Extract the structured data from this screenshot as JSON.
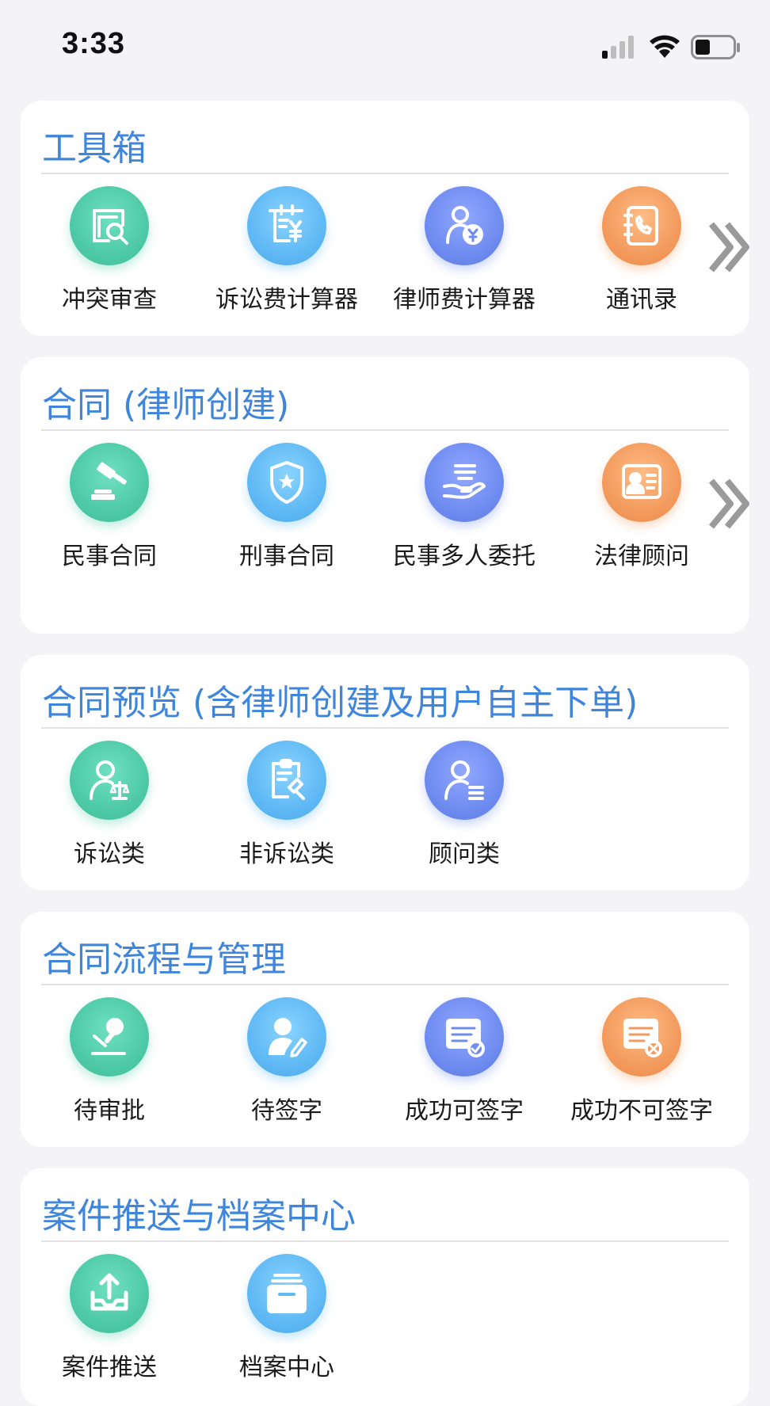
{
  "status_bar": {
    "time": "3:33"
  },
  "sections": [
    {
      "title": "工具箱",
      "items": [
        {
          "label": "冲突审查",
          "icon": "conflict-check-icon",
          "color": "#4fcaa6"
        },
        {
          "label": "诉讼费计算器",
          "icon": "litigation-fee-calculator-icon",
          "color": "#60b9f4"
        },
        {
          "label": "律师费计算器",
          "icon": "lawyer-fee-calculator-icon",
          "color": "#6f8cf0"
        },
        {
          "label": "通讯录",
          "icon": "address-book-icon",
          "color": "#f39b5e"
        }
      ],
      "has_more": true
    },
    {
      "title": "合同 (律师创建)",
      "items": [
        {
          "label": "民事合同",
          "icon": "gavel-icon",
          "color": "#4fcaa6"
        },
        {
          "label": "刑事合同",
          "icon": "shield-star-icon",
          "color": "#60b9f4"
        },
        {
          "label": "民事多人委托",
          "icon": "hand-document-icon",
          "color": "#6f8cf0"
        },
        {
          "label": "法律顾问",
          "icon": "id-card-icon",
          "color": "#f39b5e"
        }
      ],
      "has_more": true
    },
    {
      "title": "合同预览 (含律师创建及用户自主下单)",
      "items": [
        {
          "label": "诉讼类",
          "icon": "person-scale-icon",
          "color": "#4fcaa6"
        },
        {
          "label": "非诉讼类",
          "icon": "clipboard-gavel-icon",
          "color": "#60b9f4"
        },
        {
          "label": "顾问类",
          "icon": "person-list-icon",
          "color": "#6f8cf0"
        }
      ]
    },
    {
      "title": "合同流程与管理",
      "items": [
        {
          "label": "待审批",
          "icon": "stamp-icon",
          "color": "#4fcaa6"
        },
        {
          "label": "待签字",
          "icon": "person-pen-icon",
          "color": "#60b9f4"
        },
        {
          "label": "成功可签字",
          "icon": "document-check-icon",
          "color": "#6f8cf0"
        },
        {
          "label": "成功不可签字",
          "icon": "document-cross-icon",
          "color": "#f39b5e"
        }
      ]
    },
    {
      "title": "案件推送与档案中心",
      "items": [
        {
          "label": "案件推送",
          "icon": "upload-tray-icon",
          "color": "#4fcaa6"
        },
        {
          "label": "档案中心",
          "icon": "archive-box-icon",
          "color": "#60b9f4"
        }
      ]
    }
  ]
}
